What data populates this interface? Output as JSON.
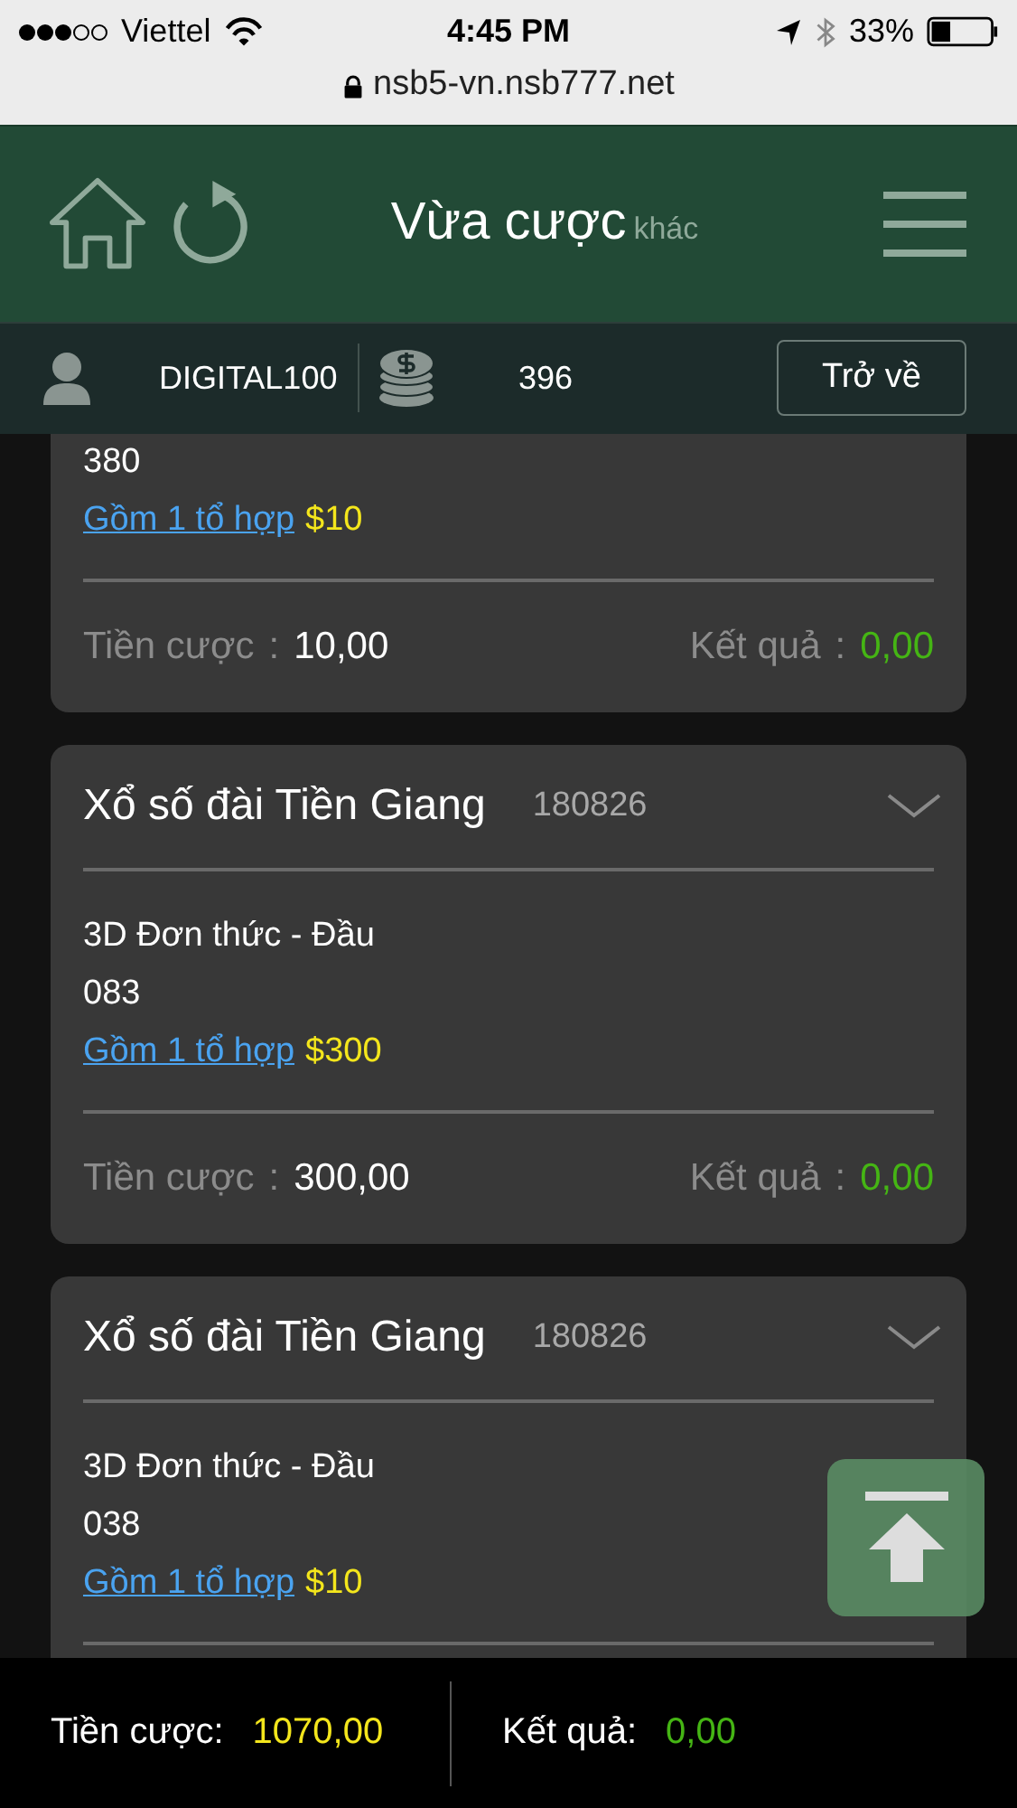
{
  "status_bar": {
    "carrier": "Viettel",
    "time": "4:45 PM",
    "battery": "33%"
  },
  "address_bar": {
    "url": "nsb5-vn.nsb777.net"
  },
  "header": {
    "title": "Vừa cược",
    "subtitle": "khác"
  },
  "user_bar": {
    "username": "DIGITAL100",
    "balance": "396",
    "back_button": "Trở về"
  },
  "bets": [
    {
      "number": "380",
      "combo_link": "Gồm 1 tổ hợp",
      "combo_amount": "$10",
      "stake_label": "Tiền cược",
      "stake_colon": ":",
      "stake": "10,00",
      "result_label": "Kết quả",
      "result_colon": ":",
      "result": "0,00"
    },
    {
      "title": "Xổ số đài Tiền Giang",
      "draw": "180826",
      "bet_type": "3D Đơn thức - Đầu",
      "number": "083",
      "combo_link": "Gồm 1 tổ hợp",
      "combo_amount": "$300",
      "stake_label": "Tiền cược",
      "stake_colon": ":",
      "stake": "300,00",
      "result_label": "Kết quả",
      "result_colon": ":",
      "result": "0,00"
    },
    {
      "title": "Xổ số đài Tiền Giang",
      "draw": "180826",
      "bet_type": "3D Đơn thức - Đầu",
      "number": "038",
      "combo_link": "Gồm 1 tổ hợp",
      "combo_amount": "$10"
    }
  ],
  "totals": {
    "stake_label": "Tiền cược:",
    "stake": "1070,00",
    "result_label": "Kết quả:",
    "result": "0,00"
  }
}
